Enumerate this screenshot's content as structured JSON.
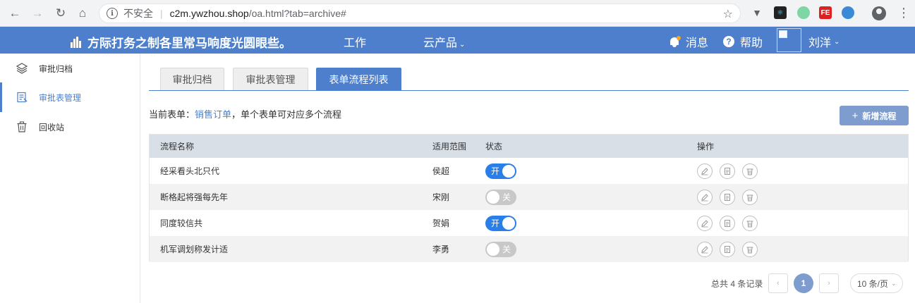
{
  "browser": {
    "security_label": "不安全",
    "url_host": "c2m.ywzhou.shop",
    "url_path": "/oa.html?tab=archive#"
  },
  "header": {
    "app_title": "方际打务之制各里常马响度光圆眼些。",
    "nav": [
      {
        "label": "工作"
      },
      {
        "label": "云产品"
      }
    ],
    "messages_label": "消息",
    "help_label": "帮助",
    "user_name": "刘洋",
    "accent_color": "#4e7fcc"
  },
  "sidebar": {
    "items": [
      {
        "label": "审批归档",
        "icon": "layers-icon"
      },
      {
        "label": "审批表管理",
        "icon": "form-list-icon",
        "active": true
      },
      {
        "label": "回收站",
        "icon": "trash-icon"
      }
    ]
  },
  "tabs": [
    {
      "label": "审批归档"
    },
    {
      "label": "审批表管理"
    },
    {
      "label": "表单流程列表",
      "active": true
    }
  ],
  "info": {
    "prefix": "当前表单：",
    "form_name": "销售订单",
    "suffix": "，单个表单可对应多个流程"
  },
  "add_button_label": "新增流程",
  "table": {
    "headers": [
      "流程名称",
      "适用范围",
      "状态",
      "操作"
    ],
    "rows": [
      {
        "name": "经采看头北只代",
        "scope": "侯超",
        "status_on": true,
        "status_label": "开"
      },
      {
        "name": "断格起将强每先年",
        "scope": "宋刚",
        "status_on": false,
        "status_label": "关"
      },
      {
        "name": "同度较信共",
        "scope": "贺娟",
        "status_on": true,
        "status_label": "开"
      },
      {
        "name": "机军调划称发计适",
        "scope": "李勇",
        "status_on": false,
        "status_label": "关"
      }
    ]
  },
  "pagination": {
    "total_text": "总共 4 条记录",
    "prev": "‹",
    "next": "›",
    "current_page": "1",
    "page_size_label": "10 条/页"
  }
}
